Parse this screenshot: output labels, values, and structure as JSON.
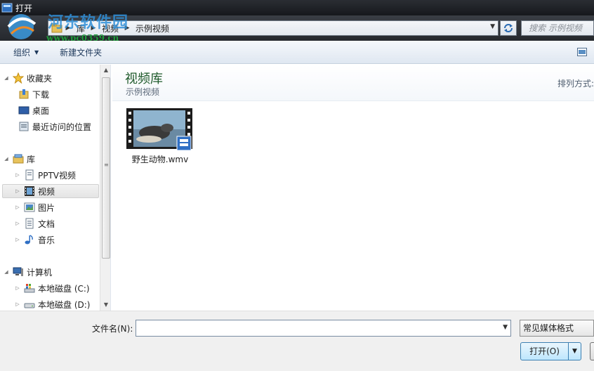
{
  "window": {
    "title": "打开"
  },
  "watermark": {
    "text": "河东软件园",
    "url": "www.pc0359.cn"
  },
  "address": {
    "crumbs": [
      "库",
      "视频",
      "示例视频"
    ],
    "search_placeholder": "搜索 示例视频"
  },
  "toolbar": {
    "organize": "组织",
    "new_folder": "新建文件夹"
  },
  "nav": {
    "favorites": "收藏夹",
    "downloads": "下载",
    "desktop": "桌面",
    "recent": "最近访问的位置",
    "libraries": "库",
    "pptv": "PPTV视频",
    "videos": "视频",
    "pictures": "图片",
    "documents": "文档",
    "music": "音乐",
    "computer": "计算机",
    "drive_c": "本地磁盘 (C:)",
    "drive_d": "本地磁盘 (D:)"
  },
  "main": {
    "library_title": "视频库",
    "library_sub": "示例视频",
    "arrange_by": "排列方式:",
    "files": [
      {
        "name": "野生动物.wmv"
      }
    ]
  },
  "bottom": {
    "filename_label": "文件名(N):",
    "filename_value": "",
    "filetype": "常见媒体格式",
    "open_label": "打开(O)"
  },
  "icons": {
    "star": "star-icon",
    "folder": "folder-icon",
    "desktop": "desktop-icon",
    "video": "film-icon",
    "music": "music-note-icon",
    "computer": "computer-icon",
    "drive": "drive-icon"
  }
}
